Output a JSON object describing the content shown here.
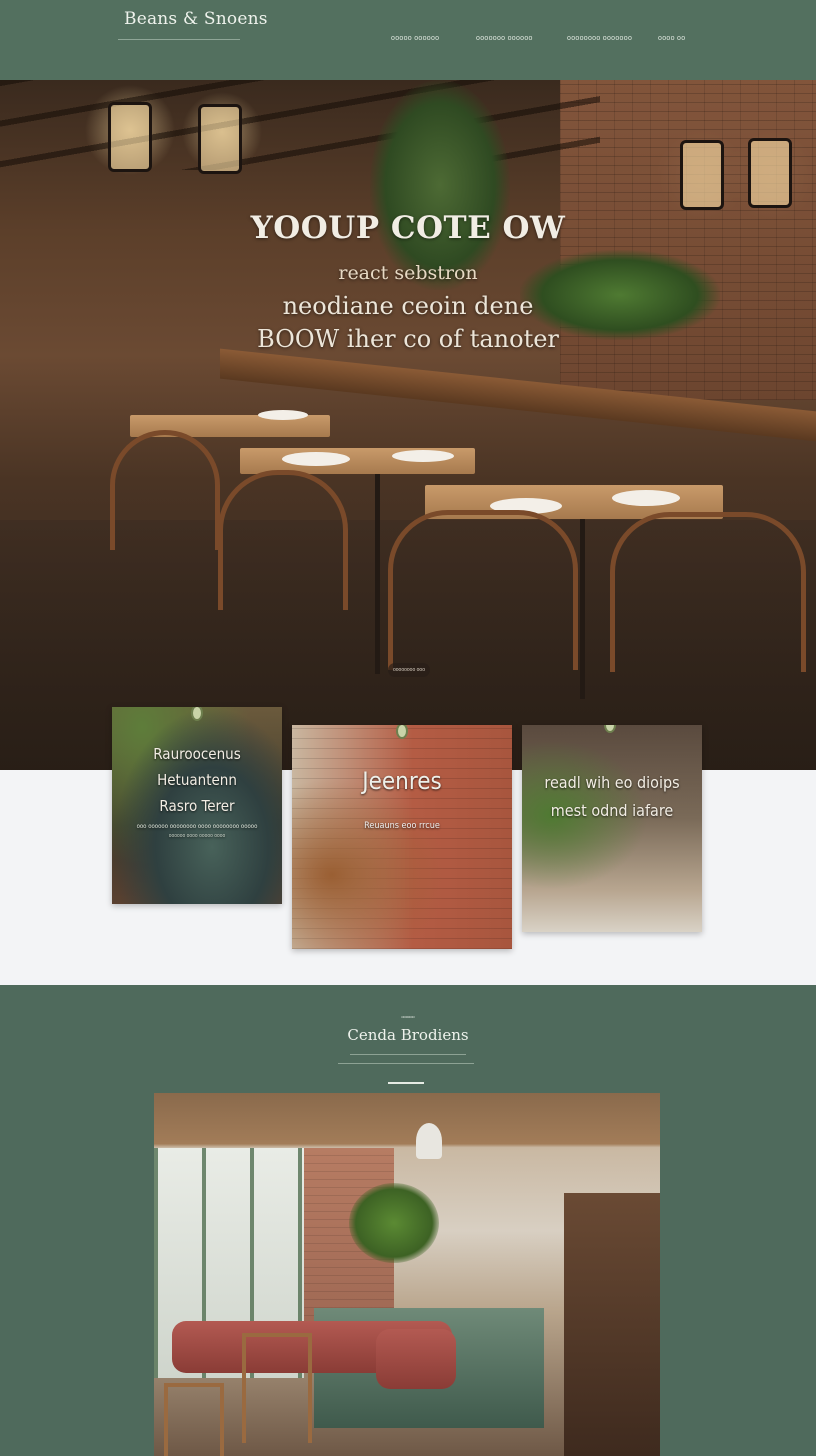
{
  "header": {
    "brand": "Beans & Snoens",
    "nav": [
      "ooooo oooooo",
      "ooooooo oooooo",
      "oooooooo ooooooo",
      "oooo oo"
    ]
  },
  "hero": {
    "title": "YOOUP COTE OW",
    "line1": "react sebstron",
    "line2": "neodiane ceoin dene",
    "line3": "BOOW iher co of tanoter",
    "pill": "oooooooo ooo"
  },
  "cards": [
    {
      "lines": [
        "Rauroocenus",
        "Hetuantenn",
        "Rasro Terer"
      ],
      "small1": "ooo oooooo oooooooo oooo oooooooo ooooo",
      "small2": "oooooo oooo ooooo oooo"
    },
    {
      "lines": [
        "Jeenres"
      ],
      "small1": "Reuauns eoo rrcue"
    },
    {
      "lines": [
        "readl wih eo dioips",
        "mest odnd iafare"
      ]
    }
  ],
  "section": {
    "kicker": "oooooo",
    "title": "Cenda Brodiens"
  },
  "icons": {
    "pin": "map-pin-icon"
  },
  "colors": {
    "header_bg": "#53705f",
    "section_bg": "#4f6a5c",
    "band_bg": "#f3f4f6"
  }
}
